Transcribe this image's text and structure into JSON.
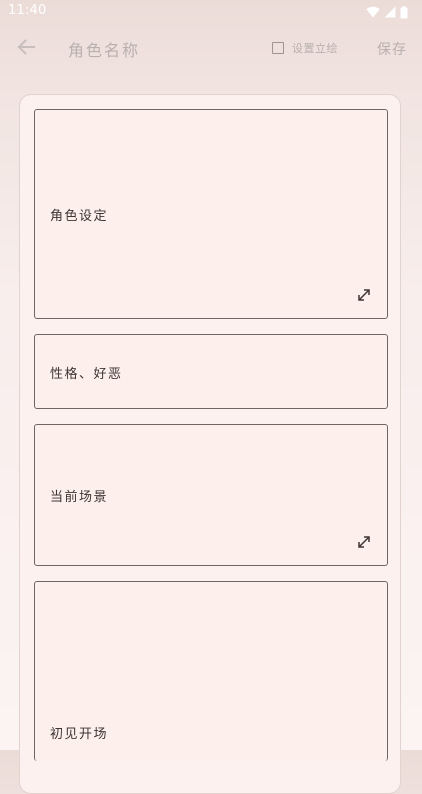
{
  "status_bar": {
    "time": "11:40",
    "icons": [
      "wifi-icon",
      "cellular-signal-icon",
      "battery-icon"
    ]
  },
  "app_bar": {
    "back_icon": "arrow-left-icon",
    "title": "角色名称",
    "portrait_toggle": {
      "checked": false,
      "label": "设置立绘"
    },
    "save_label": "保存"
  },
  "form": {
    "fields": [
      {
        "label": "角色设定",
        "value": "",
        "expandable": true
      },
      {
        "label": "性格、好恶",
        "value": "",
        "expandable": false
      },
      {
        "label": "当前场景",
        "value": "",
        "expandable": true
      },
      {
        "label": "初见开场",
        "value": "",
        "expandable": false
      }
    ]
  },
  "colors": {
    "background_top": "#ecdcd8",
    "background_bottom": "#fbf4f3",
    "card": "#fcf1ef",
    "field_border": "#6f6664",
    "muted_text": "#b9b0ae",
    "text": "#3e3533"
  }
}
